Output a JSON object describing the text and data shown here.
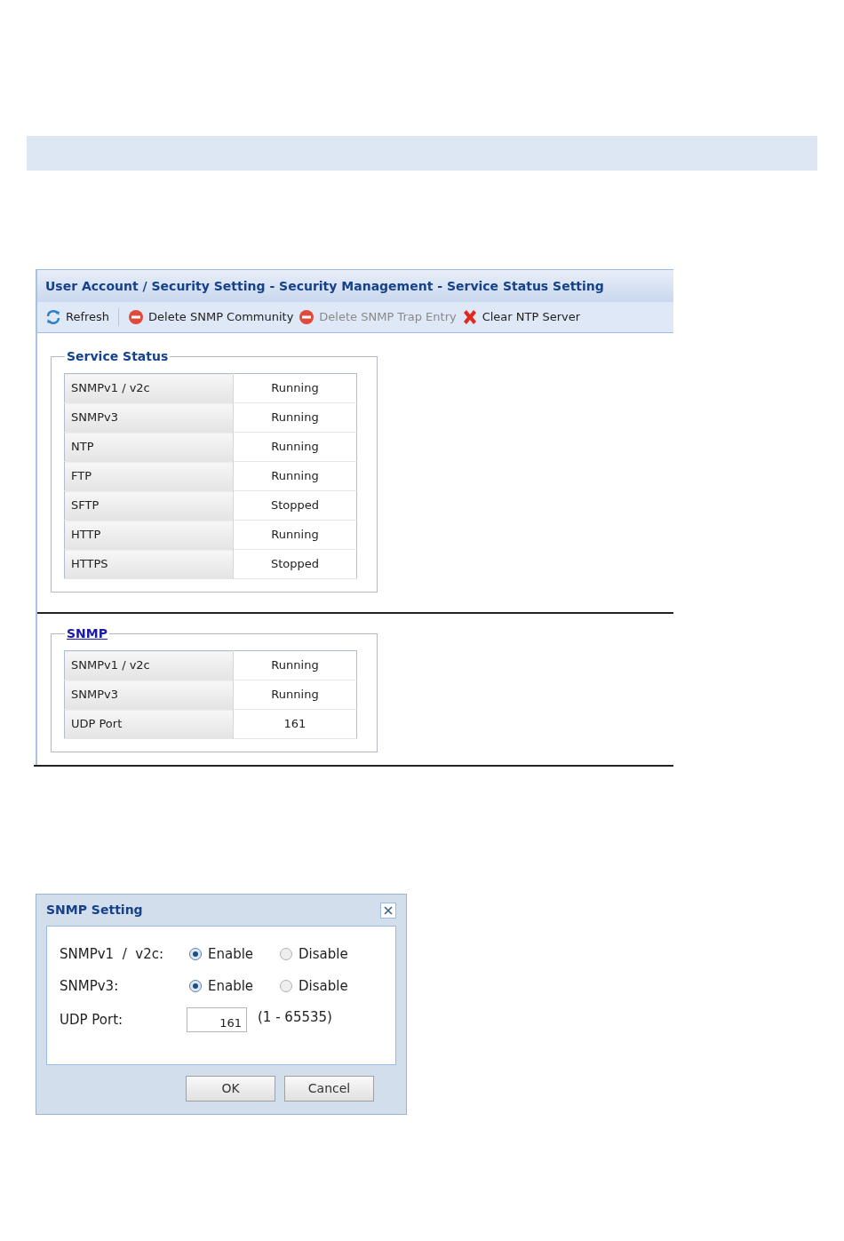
{
  "panel": {
    "title": "User Account / Security Setting - Security Management - Service Status Setting",
    "toolbar": [
      {
        "kind": "refresh",
        "label": "Refresh",
        "disabled": false
      },
      {
        "kind": "delete",
        "label": "Delete SNMP Community",
        "disabled": false
      },
      {
        "kind": "delete",
        "label": "Delete SNMP Trap Entry",
        "disabled": true
      },
      {
        "kind": "clear",
        "label": "Clear NTP Server",
        "disabled": false
      }
    ],
    "sections": [
      {
        "legend": "Service Status",
        "link": false,
        "rows": [
          {
            "name": "SNMPv1 / v2c",
            "value": "Running"
          },
          {
            "name": "SNMPv3",
            "value": "Running"
          },
          {
            "name": "NTP",
            "value": "Running"
          },
          {
            "name": "FTP",
            "value": "Running"
          },
          {
            "name": "SFTP",
            "value": "Stopped"
          },
          {
            "name": "HTTP",
            "value": "Running"
          },
          {
            "name": "HTTPS",
            "value": "Stopped"
          }
        ]
      },
      {
        "legend": "SNMP",
        "link": true,
        "rows": [
          {
            "name": "SNMPv1 / v2c",
            "value": "Running"
          },
          {
            "name": "SNMPv3",
            "value": "Running"
          },
          {
            "name": "UDP Port",
            "value": "161"
          }
        ]
      }
    ]
  },
  "dialog": {
    "title": "SNMP Setting",
    "radios": [
      {
        "label": "SNMPv1  /  v2c:",
        "options": [
          {
            "label": "Enable",
            "selected": true
          },
          {
            "label": "Disable",
            "selected": false
          }
        ]
      },
      {
        "label": "SNMPv3:",
        "options": [
          {
            "label": "Enable",
            "selected": true
          },
          {
            "label": "Disable",
            "selected": false
          }
        ]
      }
    ],
    "port": {
      "label": "UDP Port:",
      "value": "161",
      "range": "(1 - 65535)"
    },
    "buttons": [
      "OK",
      "Cancel"
    ]
  }
}
